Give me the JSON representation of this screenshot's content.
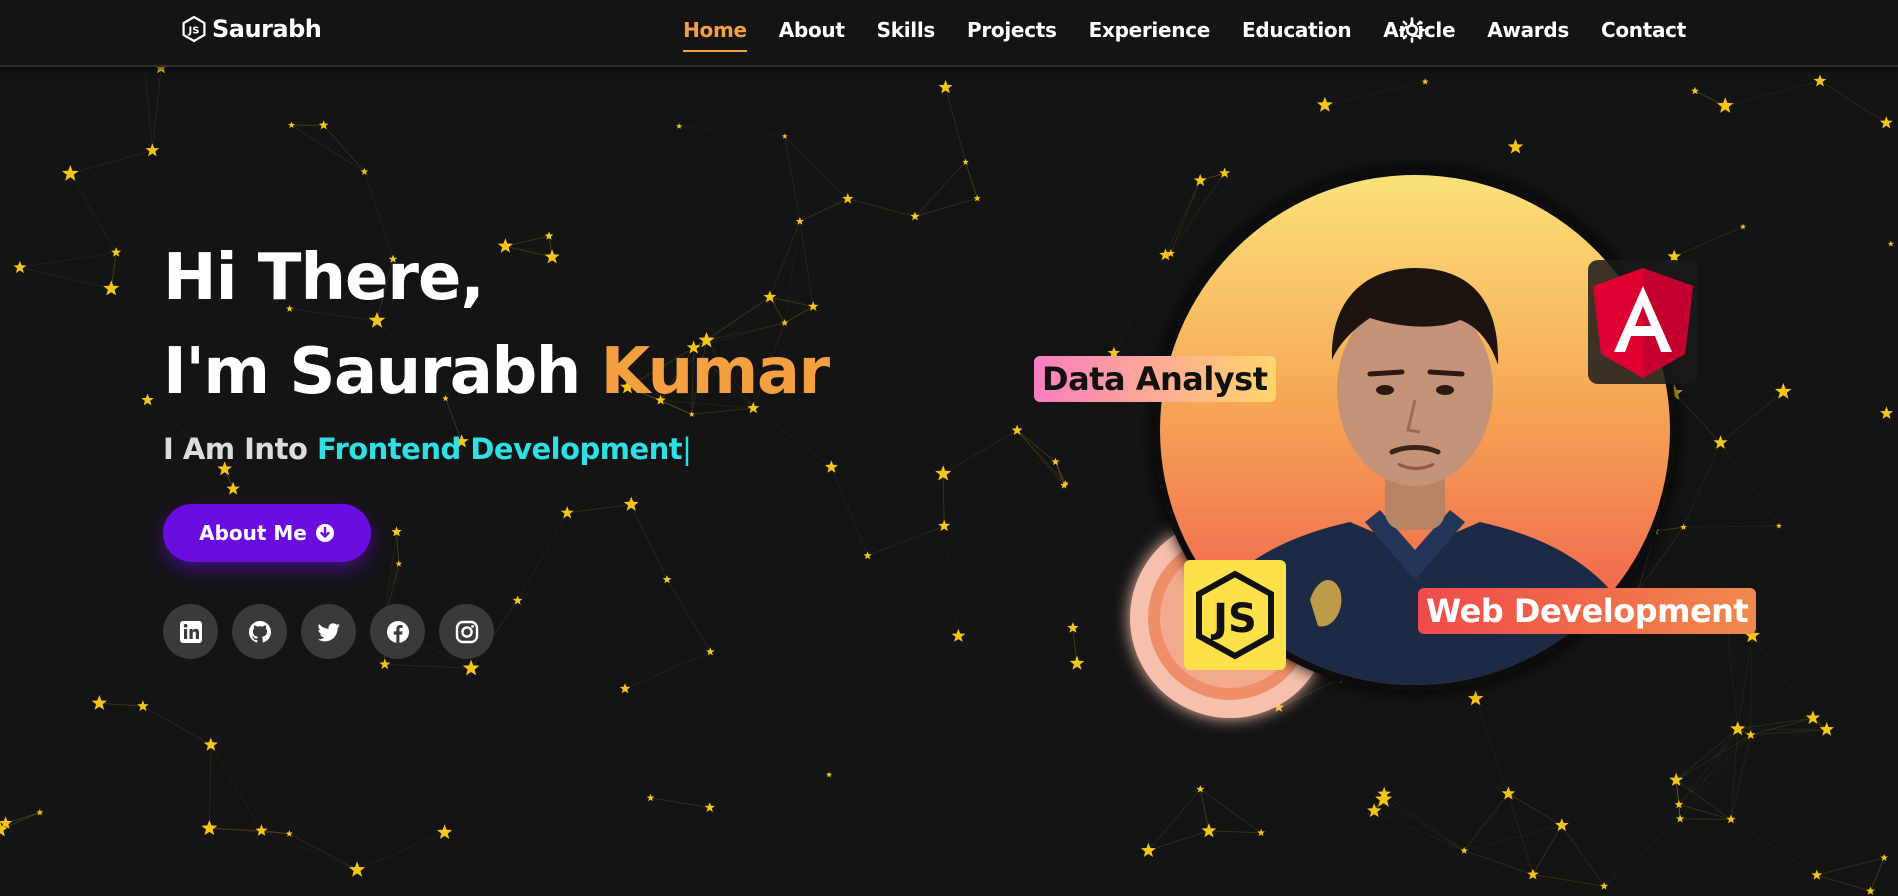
{
  "nav": {
    "brand": "Saurabh",
    "links": [
      "Home",
      "About",
      "Skills",
      "Projects",
      "Experience",
      "Education",
      "Article",
      "Awards",
      "Contact"
    ],
    "active": "Home"
  },
  "hero": {
    "greeting": "Hi There,",
    "name_prefix": "I'm Saurabh",
    "name_accent": "Kumar",
    "into_prefix": "I Am Into",
    "typed_text": "Frontend Development",
    "cursor": "|",
    "about_button": "About Me"
  },
  "art": {
    "badge_data": "Data Analyst",
    "badge_web": "Web Development"
  },
  "socials": [
    "linkedin-icon",
    "github-icon",
    "twitter-icon",
    "facebook-icon",
    "instagram-icon"
  ],
  "colors": {
    "background": "#141414",
    "accent": "#f5a040",
    "typed": "#2de0e6",
    "button": "#6a0de0",
    "particle": "#f5c518"
  }
}
